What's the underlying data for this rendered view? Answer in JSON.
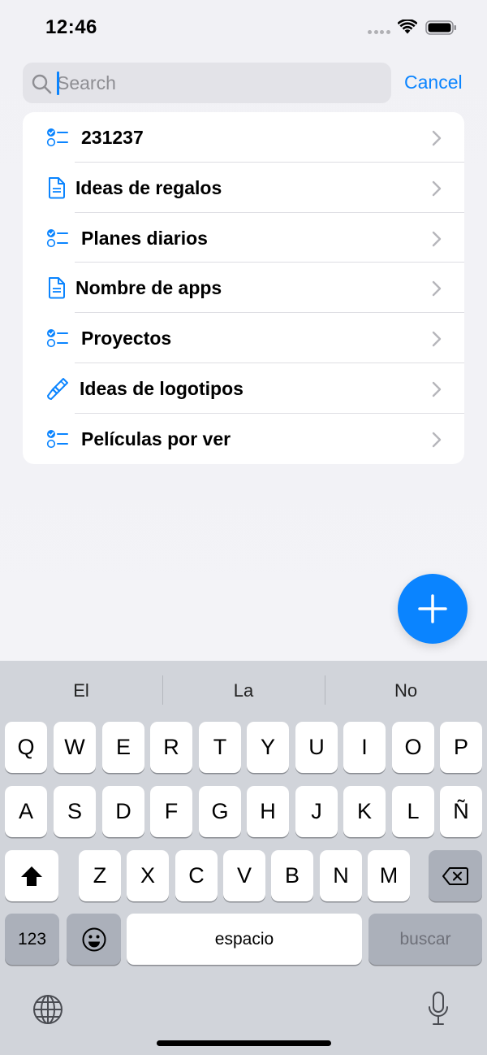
{
  "status_bar": {
    "time": "12:46"
  },
  "search": {
    "placeholder": "Search",
    "value": "",
    "cancel_label": "Cancel"
  },
  "list": {
    "items": [
      {
        "label": "231237",
        "icon": "checklist-icon"
      },
      {
        "label": "Ideas de regalos",
        "icon": "document-icon"
      },
      {
        "label": "Planes diarios",
        "icon": "checklist-icon"
      },
      {
        "label": "Nombre de apps",
        "icon": "document-icon"
      },
      {
        "label": "Proyectos",
        "icon": "checklist-icon"
      },
      {
        "label": "Ideas de logotipos",
        "icon": "paintbrush-icon"
      },
      {
        "label": "Películas por ver",
        "icon": "checklist-icon"
      }
    ]
  },
  "fab": {
    "icon": "plus-icon"
  },
  "keyboard": {
    "suggestions": [
      "El",
      "La",
      "No"
    ],
    "row1": [
      "Q",
      "W",
      "E",
      "R",
      "T",
      "Y",
      "U",
      "I",
      "O",
      "P"
    ],
    "row2": [
      "A",
      "S",
      "D",
      "F",
      "G",
      "H",
      "J",
      "K",
      "L",
      "Ñ"
    ],
    "row3": [
      "Z",
      "X",
      "C",
      "V",
      "B",
      "N",
      "M"
    ],
    "numbers_label": "123",
    "space_label": "espacio",
    "search_label": "buscar"
  },
  "colors": {
    "accent": "#0a84ff",
    "keyboard_bg": "#d1d4da",
    "background": "#f2f2f7"
  }
}
